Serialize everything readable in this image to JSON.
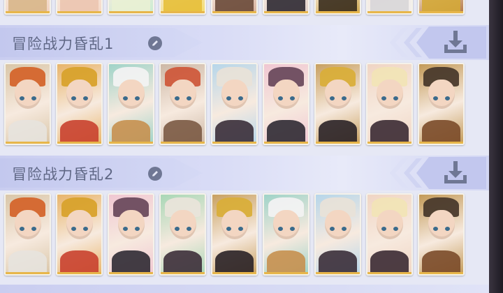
{
  "teams": [
    {
      "name": "冒险战力昏乱1",
      "edit_icon": "edit-pencil-icon",
      "download_icon": "download-icon",
      "heroes": [
        {
          "hat": "#d4652c",
          "bg": "#d9c6a8",
          "body": "#e7e3de",
          "rarity": "#e7b64a"
        },
        {
          "hat": "#d8a22c",
          "bg": "#e8b46a",
          "body": "#c9412f",
          "rarity": "#e7b64a"
        },
        {
          "hat": "#f2f2f2",
          "bg": "#9fd3c8",
          "body": "#c6904f",
          "rarity": "#e7b64a"
        },
        {
          "hat": "#cf5a3c",
          "bg": "#cdb8a6",
          "body": "#7b5a44",
          "rarity": "#e7b64a"
        },
        {
          "hat": "#e8e2d8",
          "bg": "#b6d6ea",
          "body": "#3a2e38",
          "rarity": "#e7b64a"
        },
        {
          "hat": "#6b4b5e",
          "bg": "#f0c7d2",
          "body": "#2f2a33",
          "rarity": "#e7b64a"
        },
        {
          "hat": "#d9ae3a",
          "bg": "#c8a060",
          "body": "#2a2227",
          "rarity": "#e7b64a"
        },
        {
          "hat": "#f1e4b6",
          "bg": "#f0d5c4",
          "body": "#3b2a33",
          "rarity": "#e7b64a"
        },
        {
          "hat": "#4a3a2c",
          "bg": "#c39a58",
          "body": "#7b4b2a",
          "rarity": "#e7b64a"
        }
      ]
    },
    {
      "name": "冒险战力昏乱2",
      "edit_icon": "edit-pencil-icon",
      "download_icon": "download-icon",
      "heroes": [
        {
          "hat": "#d4652c",
          "bg": "#d9c6a8",
          "body": "#e7e3de",
          "rarity": "#e7b64a"
        },
        {
          "hat": "#d8a22c",
          "bg": "#e8b46a",
          "body": "#c9412f",
          "rarity": "#e7b64a"
        },
        {
          "hat": "#6b4b5e",
          "bg": "#f0c7d2",
          "body": "#2f2a33",
          "rarity": "#e7b64a"
        },
        {
          "hat": "#e9e4da",
          "bg": "#a8d7b6",
          "body": "#3d2f3a",
          "rarity": "#e7b64a"
        },
        {
          "hat": "#d9ae3a",
          "bg": "#c8a060",
          "body": "#2a2227",
          "rarity": "#e7b64a"
        },
        {
          "hat": "#f2f2f2",
          "bg": "#9fd3c8",
          "body": "#c6904f",
          "rarity": "#e7b64a"
        },
        {
          "hat": "#e8e2d8",
          "bg": "#b6d6ea",
          "body": "#3a2e38",
          "rarity": "#e7b64a"
        },
        {
          "hat": "#f1e4b6",
          "bg": "#f0d5c4",
          "body": "#3b2a33",
          "rarity": "#e7b64a"
        },
        {
          "hat": "#4a3a2c",
          "bg": "#c39a58",
          "body": "#7b4b2a",
          "rarity": "#e7b64a"
        }
      ]
    }
  ],
  "top_partial_row": [
    {
      "hat": "#3a2f2a",
      "bg": "#f1d2c0",
      "body": "#d8b68a",
      "rarity": "#e7b64a"
    },
    {
      "hat": "#e7d7a8",
      "bg": "#f5d9c9",
      "body": "#ecc5b0",
      "rarity": "#e7b64a"
    },
    {
      "hat": "#f0e3c8",
      "bg": "#c9ecd2",
      "body": "#e9f1d4",
      "rarity": "#e7b64a"
    },
    {
      "hat": "#e9c93a",
      "bg": "#f3dd6c",
      "body": "#e7bf3a",
      "rarity": "#e7b64a"
    },
    {
      "hat": "#c1432e",
      "bg": "#d7b09b",
      "body": "#6a4a3a",
      "rarity": "#e7b64a"
    },
    {
      "hat": "#3a2e38",
      "bg": "#e0cfc9",
      "body": "#2f2a33",
      "rarity": "#e7b64a"
    },
    {
      "hat": "#6b5b2e",
      "bg": "#d0a950",
      "body": "#3a2d1e",
      "rarity": "#e7b64a"
    },
    {
      "hat": "#e2e2e2",
      "bg": "#f1efee",
      "body": "#d8d6d8",
      "rarity": "#e7b64a"
    },
    {
      "hat": "#2e2a2a",
      "bg": "#b37846",
      "body": "#d4a838",
      "rarity": "#e7b64a"
    }
  ]
}
